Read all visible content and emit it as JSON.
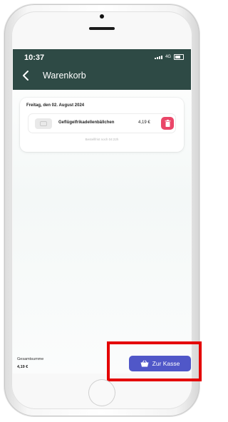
{
  "status_bar": {
    "time": "10:37",
    "network": "4G"
  },
  "header": {
    "title": "Warenkorb",
    "back_icon": "chevron-left-icon"
  },
  "cart": {
    "date_label": "Freitag, den 02. August 2024",
    "items": [
      {
        "name": "Geflügelfrikadellenbällchen",
        "price": "4,19 €",
        "delete_icon": "trash-icon"
      }
    ],
    "note": "Bestellfrist noch 04:22h"
  },
  "footer": {
    "total_label": "Gesamtsumme",
    "total_value": "4,19 €",
    "checkout_label": "Zur Kasse",
    "checkout_icon": "basket-icon"
  },
  "colors": {
    "app_bar": "#2e4a45",
    "accent": "#5057c8",
    "delete": "#ea4668",
    "highlight": "#e40000"
  }
}
